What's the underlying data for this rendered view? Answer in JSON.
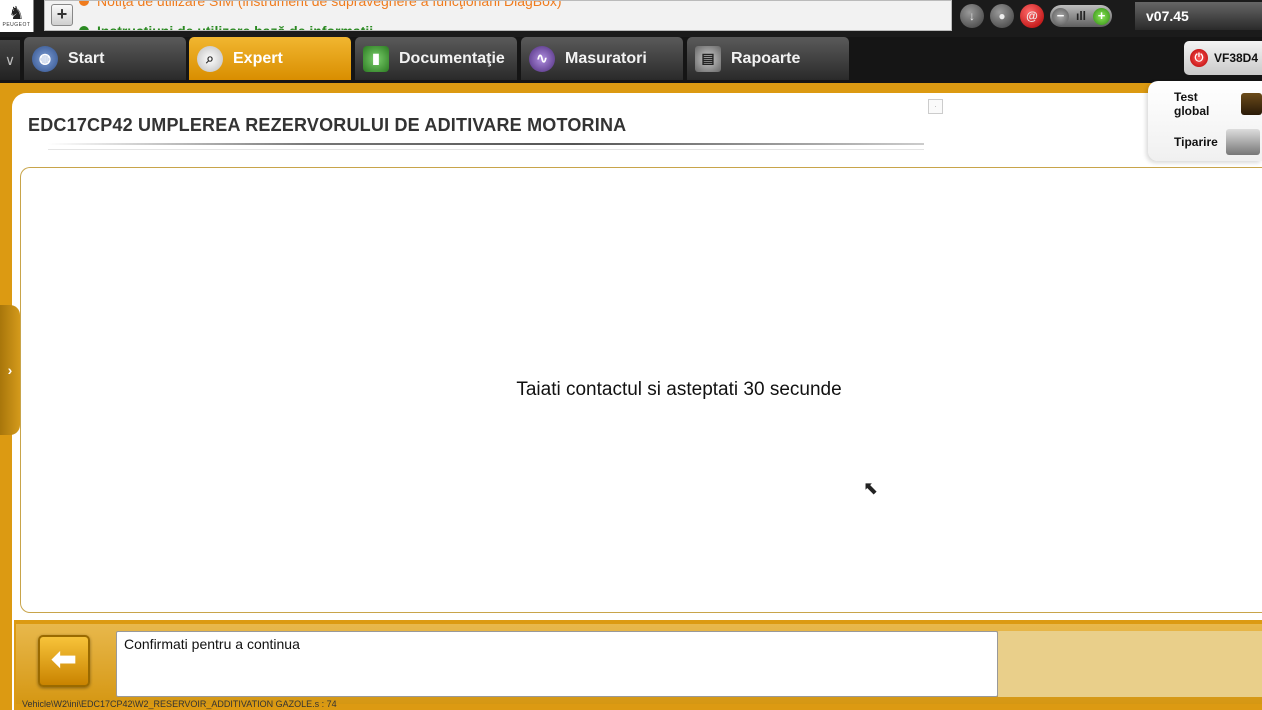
{
  "logo": {
    "brand": "PEUGEOT"
  },
  "notifications": [
    {
      "text": "Notiţa de utilizare SIM (instrument de supraveghere a funcţionării DiagBox)",
      "color": "#f07c1e"
    },
    {
      "text": "Instrucţiuni de utilizare bază de informaţii",
      "color": "#2b8a22"
    }
  ],
  "toolbar": {
    "icons": [
      "download-icon",
      "user-icon",
      "email-icon"
    ],
    "version": "v07.45"
  },
  "tabs": [
    {
      "label": "Start",
      "icon": "globe-icon",
      "active": false
    },
    {
      "label": "Expert",
      "icon": "magnifier-icon",
      "active": true
    },
    {
      "label": "Documentaţie",
      "icon": "book-icon",
      "active": false
    },
    {
      "label": "Masuratori",
      "icon": "waveform-icon",
      "active": false
    },
    {
      "label": "Rapoarte",
      "icon": "report-icon",
      "active": false
    }
  ],
  "vehicle": {
    "label": "VF38D4"
  },
  "side_panel": {
    "test_global": "Test global",
    "print": "Tiparire"
  },
  "page": {
    "title": "EDC17CP42  UMPLEREA REZERVORULUI DE ADITIVARE MOTORINA",
    "message": "Taiati contactul si asteptati 30 secunde"
  },
  "footer": {
    "confirm_text": "Confirmati pentru a continua",
    "path": "Vehicle\\W2\\ini\\EDC17CP42\\W2_RESERVOIR_ADDITIVATION GAZOLE.s : 74"
  },
  "colors": {
    "accent": "#dc9a12",
    "tab_active": "#f1b630",
    "dark": "#1b1b1b"
  }
}
